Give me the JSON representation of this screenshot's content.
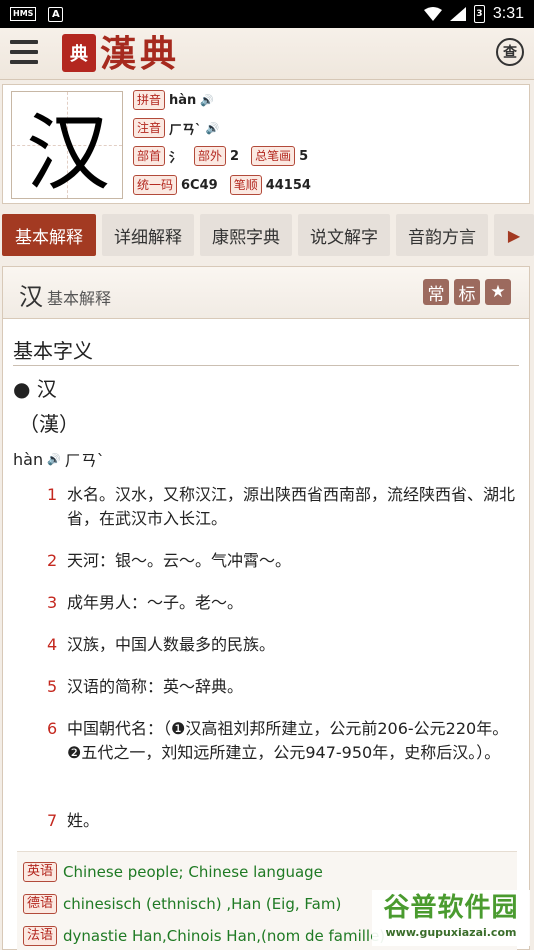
{
  "status_bar": {
    "left_chip": "HMS",
    "left_letter": "A",
    "battery": "3",
    "time": "3:31"
  },
  "app_bar": {
    "logo_seal": "典",
    "logo_text": "漢典",
    "search_icon_glyph": "查"
  },
  "char": {
    "glyph": "汉",
    "pinyin_label": "拼音",
    "pinyin": "hàn",
    "zhuyin_label": "注音",
    "zhuyin": "ㄏㄢˋ",
    "radical_label": "部首",
    "radical": "氵",
    "extra_label": "部外",
    "extra": "2",
    "strokes_label": "总笔画",
    "strokes": "5",
    "unicode_label": "统一码",
    "unicode": "6C49",
    "order_label": "笔顺",
    "order": "44154"
  },
  "tabs": [
    "基本解释",
    "详细解释",
    "康熙字典",
    "说文解字",
    "音韵方言"
  ],
  "content": {
    "header_char": "汉",
    "header_label": "基本解释",
    "badges": [
      "常",
      "标"
    ],
    "section_title": "基本字义",
    "entry": "● 汉",
    "traditional": "（漢）",
    "pinyin": "hàn",
    "zhuyin": "ㄏㄢˋ",
    "definitions": [
      {
        "n": "1",
        "text": "水名。汉水，又称汉江，源出陕西省西南部，流经陕西省、湖北省，在武汉市入长江。"
      },
      {
        "n": "2",
        "text": "天河：银～。云～。气冲霄～。"
      },
      {
        "n": "3",
        "text": "成年男人：～子。老～。"
      },
      {
        "n": "4",
        "text": "汉族，中国人数最多的民族。"
      },
      {
        "n": "5",
        "text": "汉语的简称：英～辞典。"
      },
      {
        "n": "6",
        "text": "中国朝代名：（❶汉高祖刘邦所建立，公元前206-公元220年。❷五代之一，刘知远所建立，公元947-950年，史称后汉。）。"
      },
      {
        "n": "7",
        "text": "姓。"
      }
    ],
    "translations": [
      {
        "lang": "英语",
        "text": "Chinese people; Chinese language"
      },
      {
        "lang": "德语",
        "text": "chinesisch (ethnisch) ,Han (Eig, Fam)"
      },
      {
        "lang": "法语",
        "text": "dynastie Han,Chinois Han,(nom de famille)"
      }
    ]
  },
  "watermark": {
    "title": "谷普软件园",
    "url": "www.gupuxiazai.com"
  }
}
